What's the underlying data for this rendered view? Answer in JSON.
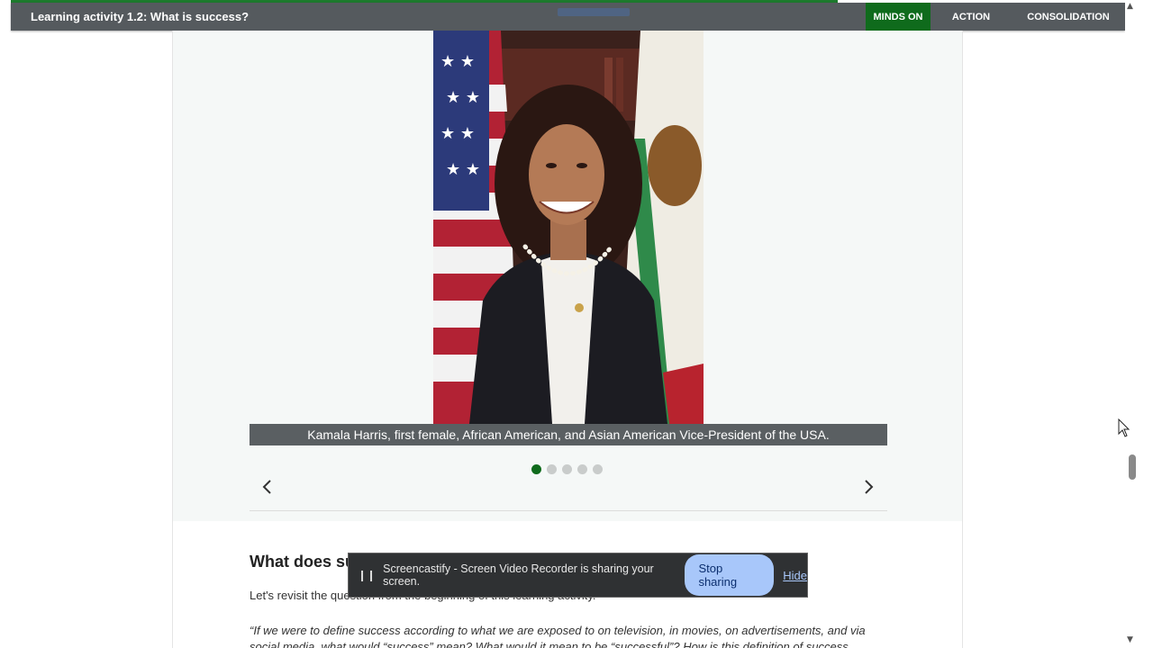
{
  "header": {
    "title": "Learning activity 1.2: What is success?",
    "tabs": [
      {
        "label": "MINDS ON",
        "active": true
      },
      {
        "label": "ACTION",
        "active": false
      },
      {
        "label": "CONSOLIDATION",
        "active": false
      }
    ]
  },
  "carousel": {
    "caption": "Kamala Harris, first female, African American, and Asian American Vice-President of the USA.",
    "slide_count": 5,
    "active_slide": 1,
    "prev_icon": "chevron-left-icon",
    "next_icon": "chevron-right-icon"
  },
  "section": {
    "heading": "What does su",
    "paragraph1": "Let's revisit the que",
    "paragraph1_tail": "stion from the beginning of this learning activity.",
    "quote": "“If we were to define success according to what we are exposed to on television, in movies, on advertisements, and via social media, what would “success” mean? What would it mean to be “successful”? How is this definition of success"
  },
  "screencastify": {
    "message": "Screencastify - Screen Video Recorder is sharing your screen.",
    "stop_label": "Stop sharing",
    "hide_label": "Hide"
  },
  "colors": {
    "accent_green": "#0f6b1c",
    "topbar_gray": "#555a5e",
    "share_button": "#a8c7fa"
  }
}
